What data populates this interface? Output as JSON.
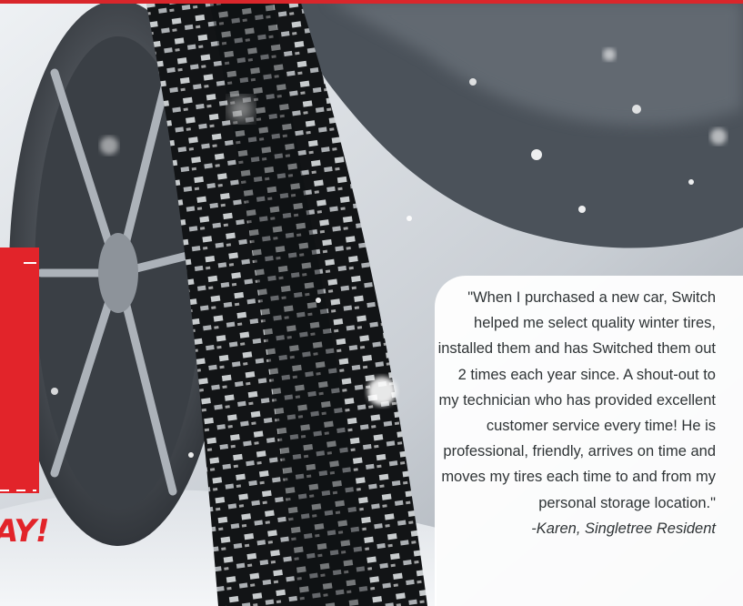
{
  "promo_text": "AY!",
  "testimonial": {
    "quote": "\"When I purchased a new car, Switch helped me select quality winter tires, installed them and has Switched them out 2 times each year since. A shout-out to my technician who has provided excellent customer service every time!  He is professional, friendly, arrives on time and moves my tires each time to and from my personal storage location.\"",
    "attribution": "-Karen, Singletree Resident"
  },
  "colors": {
    "accent_red": "#e2242a",
    "card_background": "#ffffff",
    "text": "#2f3436"
  }
}
